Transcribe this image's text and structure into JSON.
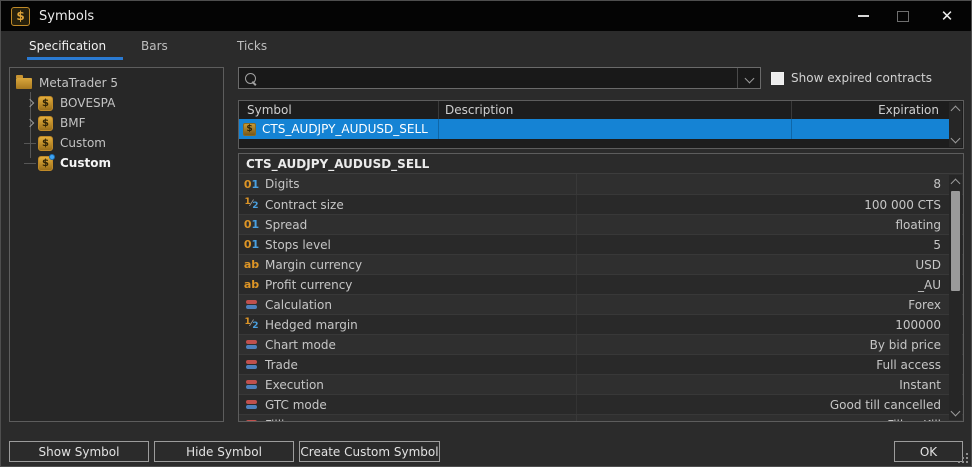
{
  "window": {
    "title": "Symbols"
  },
  "titlebar_controls": [
    "minimize",
    "maximize",
    "close"
  ],
  "tabs": [
    {
      "label": "Specification",
      "active": true
    },
    {
      "label": "Bars",
      "active": false
    },
    {
      "label": "Ticks",
      "active": false
    }
  ],
  "tree": {
    "root": {
      "label": "MetaTrader 5",
      "icon": "folder-icon"
    },
    "items": [
      {
        "label": "BOVESPA",
        "icon": "dollar-symbol-icon",
        "expandable": true,
        "selected": false,
        "modified": false
      },
      {
        "label": "BMF",
        "icon": "dollar-symbol-icon",
        "expandable": true,
        "selected": false,
        "modified": false
      },
      {
        "label": "Custom",
        "icon": "dollar-symbol-icon",
        "expandable": false,
        "selected": false,
        "modified": false
      },
      {
        "label": "Custom",
        "icon": "dollar-symbol-icon",
        "expandable": false,
        "selected": true,
        "modified": true
      }
    ]
  },
  "search": {
    "value": "",
    "placeholder": "",
    "icon": "search-icon",
    "dropdown_icon": "chevron-down-icon"
  },
  "expired_checkbox": {
    "label": "Show expired contracts",
    "checked": false
  },
  "symbols_table": {
    "columns": [
      "Symbol",
      "Description",
      "Expiration"
    ],
    "rows": [
      {
        "symbol": "CTS_AUDJPY_AUDUSD_SELL",
        "description": "",
        "expiration": "",
        "selected": true,
        "icon": "custom-symbol-icon"
      }
    ]
  },
  "specification": {
    "title": "CTS_AUDJPY_AUDUSD_SELL",
    "rows": [
      {
        "icon": "numeric-icon",
        "property": "Digits",
        "value": "8"
      },
      {
        "icon": "fraction-icon",
        "property": "Contract size",
        "value": "100 000 CTS"
      },
      {
        "icon": "numeric-icon",
        "property": "Spread",
        "value": "floating"
      },
      {
        "icon": "numeric-icon",
        "property": "Stops level",
        "value": "5"
      },
      {
        "icon": "text-icon",
        "property": "Margin currency",
        "value": "USD"
      },
      {
        "icon": "text-icon",
        "property": "Profit currency",
        "value": "_AU"
      },
      {
        "icon": "enum-icon",
        "property": "Calculation",
        "value": "Forex"
      },
      {
        "icon": "fraction-icon",
        "property": "Hedged margin",
        "value": "100000"
      },
      {
        "icon": "enum-icon",
        "property": "Chart mode",
        "value": "By bid price"
      },
      {
        "icon": "enum-icon",
        "property": "Trade",
        "value": "Full access"
      },
      {
        "icon": "enum-icon",
        "property": "Execution",
        "value": "Instant"
      },
      {
        "icon": "enum-icon",
        "property": "GTC mode",
        "value": "Good till cancelled"
      },
      {
        "icon": "enum-icon",
        "property": "Filling",
        "value": "Fill or Kill"
      }
    ]
  },
  "footer": {
    "show_symbol": "Show Symbol",
    "hide_symbol": "Hide Symbol",
    "create_custom_symbol": "Create Custom Symbol",
    "ok": "OK"
  },
  "colors": {
    "titlebar_bg": "#040404",
    "body_bg": "#2b2b2b",
    "selection_blue": "#1583d4",
    "tab_underline": "#2a7ad2",
    "icon_orange": "#dd9526",
    "icon_blue": "#4aa0e0",
    "enum_red": "#c0504d",
    "enum_blue": "#4f81bd",
    "gold": "#d79a2c"
  }
}
